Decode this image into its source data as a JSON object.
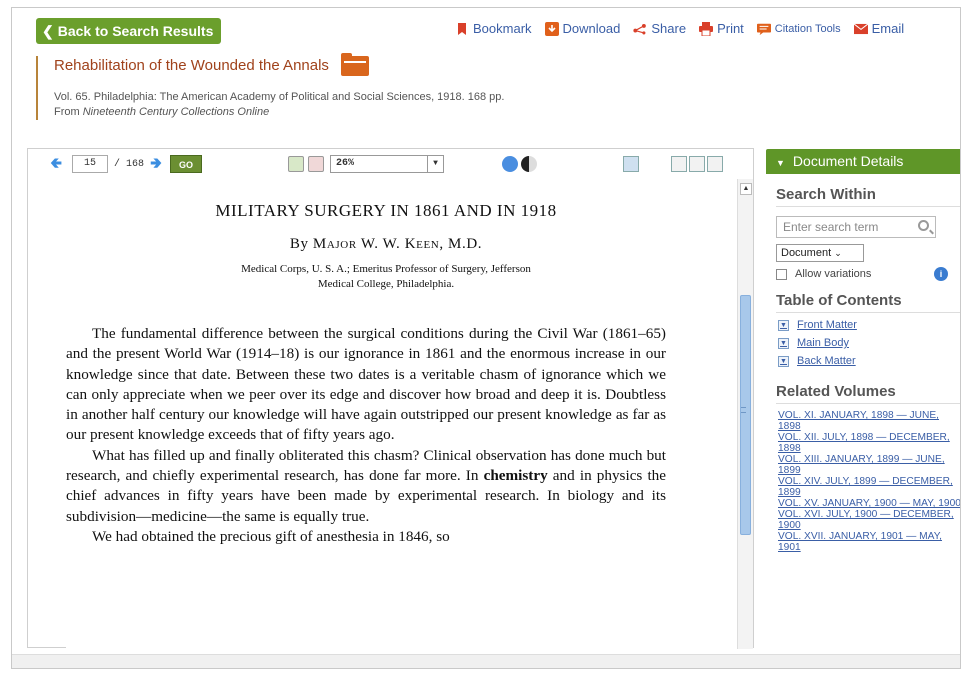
{
  "nav": {
    "back_label": "Back to Search Results"
  },
  "tools": [
    {
      "name": "bookmark",
      "label": "Bookmark",
      "icon": "bookmark-icon",
      "color": "#d9402a"
    },
    {
      "name": "download",
      "label": "Download",
      "icon": "download-icon",
      "color": "#e0601b"
    },
    {
      "name": "share",
      "label": "Share",
      "icon": "share-icon",
      "color": "#d9402a"
    },
    {
      "name": "print",
      "label": "Print",
      "icon": "print-icon",
      "color": "#d9402a"
    },
    {
      "name": "citation",
      "label": "Citation Tools",
      "icon": "citation-icon",
      "color": "#e0601b"
    },
    {
      "name": "email",
      "label": "Email",
      "icon": "email-icon",
      "color": "#d9402a"
    }
  ],
  "document": {
    "title": "Rehabilitation of the Wounded the Annals",
    "meta_line": "Vol. 65. Philadelphia: The American Academy of Political and Social Sciences, 1918. 168 pp.",
    "source_prefix": "From ",
    "source_name": "Nineteenth Century Collections Online"
  },
  "viewer": {
    "page_current": "15",
    "page_total": "/ 168",
    "go_label": "GO",
    "zoom": "26%"
  },
  "page_text": {
    "title": "MILITARY SURGERY IN 1861 AND IN 1918",
    "author_prefix": "By ",
    "author": "Major W. W. Keen, M.D.",
    "affiliation_1": "Medical Corps, U. S. A.; Emeritus Professor of Surgery, Jefferson",
    "affiliation_2": "Medical College, Philadelphia.",
    "para_1": "The fundamental difference between the surgical conditions during the Civil War (1861–65) and the present World War (1914–18) is our ignorance in 1861 and the enormous increase in our knowledge since that date. Between these two dates is a veritable chasm of ignorance which we can only appreciate when we peer over its edge and discover how broad and deep it is. Doubtless in another half century our knowledge will have again outstripped our present knowledge as far as our present knowledge exceeds that of fifty years ago.",
    "para_2a": "What has filled up and finally obliterated this chasm? Clinical observation has done much but research, and chiefly experimental research, has done far more. In ",
    "para_2b": "chemistry",
    "para_2c": " and in physics the chief advances in fifty years have been made by experimental research. In biology and its subdivision—medicine—the same is equally true.",
    "para_3": "We had obtained the precious gift of anesthesia in 1846, so"
  },
  "sidebar": {
    "header": "Document Details",
    "search_within": "Search Within",
    "search_placeholder": "Enter search term",
    "scope_select": "Document",
    "allow_variations": "Allow variations",
    "toc_heading": "Table of Contents",
    "toc": [
      "Front Matter",
      "Main Body",
      "Back Matter"
    ],
    "related_heading": "Related Volumes",
    "volumes": [
      "VOL. XI. JANUARY, 1898 — JUNE, 1898",
      "VOL. XII. JULY, 1898 — DECEMBER, 1898",
      "VOL. XIII. JANUARY, 1899 — JUNE, 1899",
      "VOL. XIV. JULY, 1899 — DECEMBER, 1899",
      "VOL. XV. JANUARY, 1900 — MAY, 1900",
      "VOL. XVI. JULY, 1900 — DECEMBER, 1900",
      "VOL. XVII. JANUARY, 1901 — MAY, 1901"
    ]
  }
}
